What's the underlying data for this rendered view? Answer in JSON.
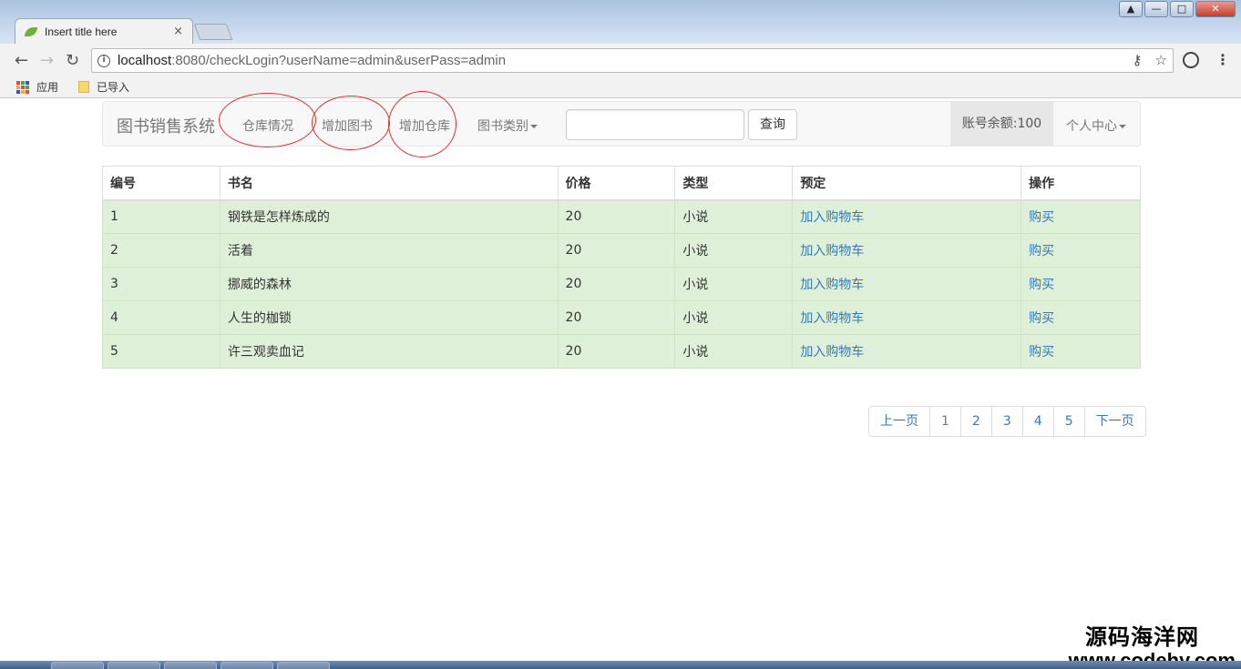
{
  "browser": {
    "tab_title": "Insert title here",
    "tab_close": "×",
    "url_host": "localhost",
    "url_rest": ":8080/checkLogin?userName=admin&userPass=admin",
    "bookmarks": [
      "应用",
      "已导入"
    ],
    "window_buttons": [
      "▲",
      "—",
      "□",
      "✕"
    ]
  },
  "navbar": {
    "brand": "图书销售系统",
    "links": [
      "仓库情况",
      "增加图书",
      "增加仓库"
    ],
    "dropdown_category": "图书类别",
    "search_placeholder": "",
    "search_button": "查询",
    "balance": "账号余额:100",
    "user_center": "个人中心"
  },
  "table": {
    "headers": [
      "编号",
      "书名",
      "价格",
      "类型",
      "预定",
      "操作"
    ],
    "rows": [
      {
        "id": "1",
        "name": "钢铁是怎样炼成的",
        "price": "20",
        "type": "小说",
        "reserve": "加入购物车",
        "action": "购买"
      },
      {
        "id": "2",
        "name": "活着",
        "price": "20",
        "type": "小说",
        "reserve": "加入购物车",
        "action": "购买"
      },
      {
        "id": "3",
        "name": "挪威的森林",
        "price": "20",
        "type": "小说",
        "reserve": "加入购物车",
        "action": "购买"
      },
      {
        "id": "4",
        "name": "人生的枷锁",
        "price": "20",
        "type": "小说",
        "reserve": "加入购物车",
        "action": "购买"
      },
      {
        "id": "5",
        "name": "许三观卖血记",
        "price": "20",
        "type": "小说",
        "reserve": "加入购物车",
        "action": "购买"
      }
    ]
  },
  "pagination": {
    "prev": "上一页",
    "pages": [
      "1",
      "2",
      "3",
      "4",
      "5"
    ],
    "next": "下一页"
  },
  "watermark": {
    "cn": "源码海洋网",
    "url": "www.codehy.com"
  },
  "colors": {
    "row_success": "#dff0d8",
    "link": "#337ab7",
    "annotation_circle": "#dd3333"
  }
}
